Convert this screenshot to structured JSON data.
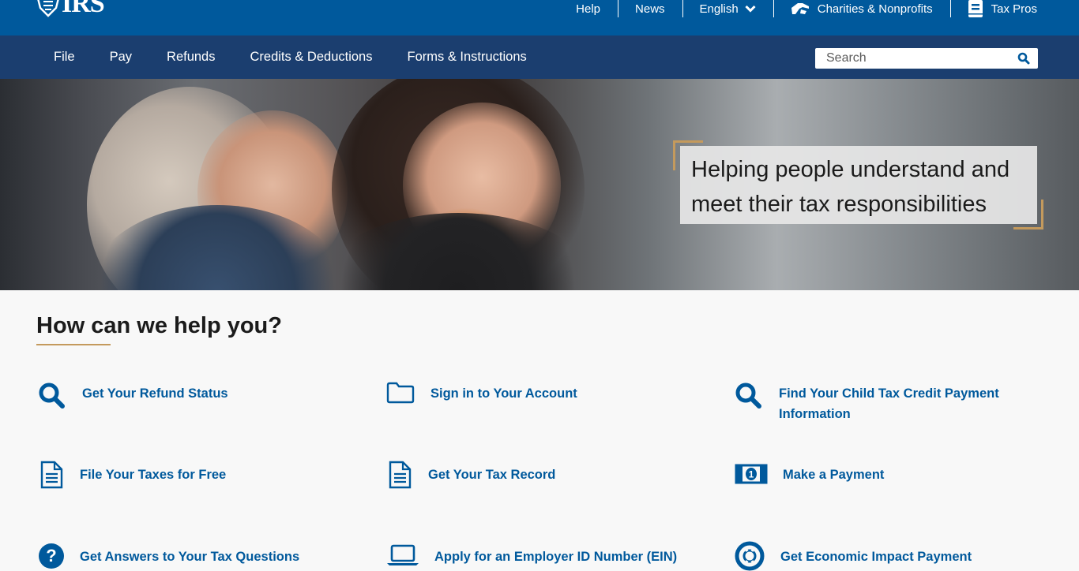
{
  "header": {
    "logo_text": "IRS",
    "utility_links": [
      {
        "label": "Help"
      },
      {
        "label": "News"
      },
      {
        "label": "English"
      },
      {
        "label": "Charities & Nonprofits"
      },
      {
        "label": "Tax Pros"
      }
    ]
  },
  "nav": {
    "items": [
      {
        "label": "File"
      },
      {
        "label": "Pay"
      },
      {
        "label": "Refunds"
      },
      {
        "label": "Credits & Deductions"
      },
      {
        "label": "Forms & Instructions"
      }
    ],
    "search": {
      "placeholder": "Search",
      "value": ""
    }
  },
  "hero": {
    "tagline": "Helping people understand and meet their tax responsibilities"
  },
  "help": {
    "title": "How can we help you?",
    "tiles": [
      {
        "label": "Get Your Refund Status",
        "icon": "search-icon"
      },
      {
        "label": "Sign in to Your Account",
        "icon": "folder-icon"
      },
      {
        "label": "Find Your Child Tax Credit Payment Information",
        "icon": "search-icon"
      },
      {
        "label": "File Your Taxes for Free",
        "icon": "document-icon"
      },
      {
        "label": "Get Your Tax Record",
        "icon": "document-icon"
      },
      {
        "label": "Make a Payment",
        "icon": "money-icon"
      },
      {
        "label": "Get Answers to Your Tax Questions",
        "icon": "question-icon"
      },
      {
        "label": "Apply for an Employer ID Number (EIN)",
        "icon": "laptop-icon"
      },
      {
        "label": "Get Economic Impact Payment",
        "icon": "lifebuoy-icon"
      }
    ]
  },
  "colors": {
    "top_bar": "#00599c",
    "main_nav": "#1b3e6f",
    "link": "#00599c",
    "accent": "#c49a5d"
  }
}
